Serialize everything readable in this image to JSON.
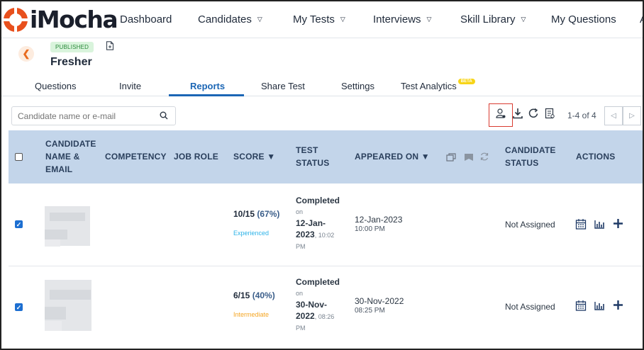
{
  "brand": {
    "logo_text": "iMocha",
    "logo_color": "#e8501d"
  },
  "nav": [
    "Dashboard",
    "Candidates",
    "My Tests",
    "Interviews",
    "Skill Library",
    "My Questions",
    "A"
  ],
  "nav_has_caret": [
    false,
    true,
    true,
    true,
    true,
    false,
    false
  ],
  "test": {
    "status_badge": "PUBLISHED",
    "title": "Fresher"
  },
  "tabs": [
    {
      "label": "Questions"
    },
    {
      "label": "Invite"
    },
    {
      "label": "Reports",
      "active": true
    },
    {
      "label": "Share Test"
    },
    {
      "label": "Settings"
    },
    {
      "label": "Test Analytics",
      "badge": "BETA"
    }
  ],
  "search": {
    "placeholder": "Candidate name or e-mail"
  },
  "pager": {
    "text": "1-4 of 4"
  },
  "table": {
    "headers": {
      "candidate": [
        "CANDIDATE",
        "NAME &",
        "EMAIL"
      ],
      "competency": "COMPETENCY",
      "job_role": "JOB ROLE",
      "score": "SCORE",
      "test_status": [
        "TEST",
        "STATUS"
      ],
      "appeared_on": "APPEARED ON",
      "candidate_status": [
        "CANDIDATE",
        "STATUS"
      ],
      "actions": "ACTIONS"
    },
    "rows": [
      {
        "checked": true,
        "score": "10/15",
        "score_pct": "(67%)",
        "level": "Experienced",
        "level_color": "#2db3e8",
        "status": "Completed",
        "status_on": "on",
        "status_date": "12-Jan-",
        "status_year": "2023",
        "status_time": ", 10:02",
        "status_ampm": "PM",
        "appeared_date": "12-Jan-2023",
        "appeared_time": "10:00 PM",
        "candidate_status": "Not Assigned"
      },
      {
        "checked": true,
        "score": "6/15",
        "score_pct": "(40%)",
        "level": "Intermediate",
        "level_color": "#f5a623",
        "status": "Completed",
        "status_on": "on",
        "status_date": "30-Nov-",
        "status_year": "2022",
        "status_time": ", 08:26",
        "status_ampm": "PM",
        "appeared_date": "30-Nov-2022",
        "appeared_time": "08:25 PM",
        "candidate_status": "Not Assigned"
      }
    ]
  },
  "icons": {
    "toolbar": [
      "assign-user-icon",
      "download-icon",
      "refresh-icon",
      "report-icon"
    ],
    "actions": [
      "calendar-icon",
      "bar-chart-icon",
      "plus-icon"
    ]
  }
}
